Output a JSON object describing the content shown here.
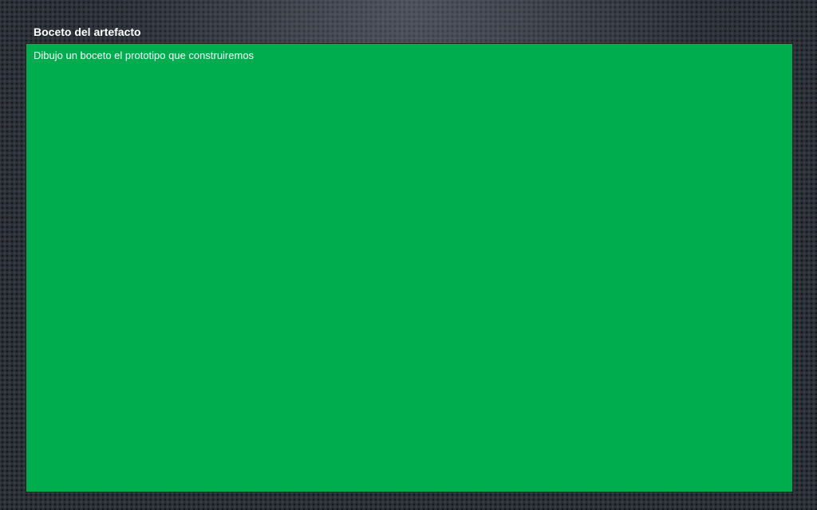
{
  "slide": {
    "title": "Boceto del artefacto",
    "box_text": "Dibujo un boceto el prototipo que construiremos"
  },
  "colors": {
    "background": "#2b2f37",
    "box_fill": "#00ad4e",
    "text": "#ffffff"
  }
}
